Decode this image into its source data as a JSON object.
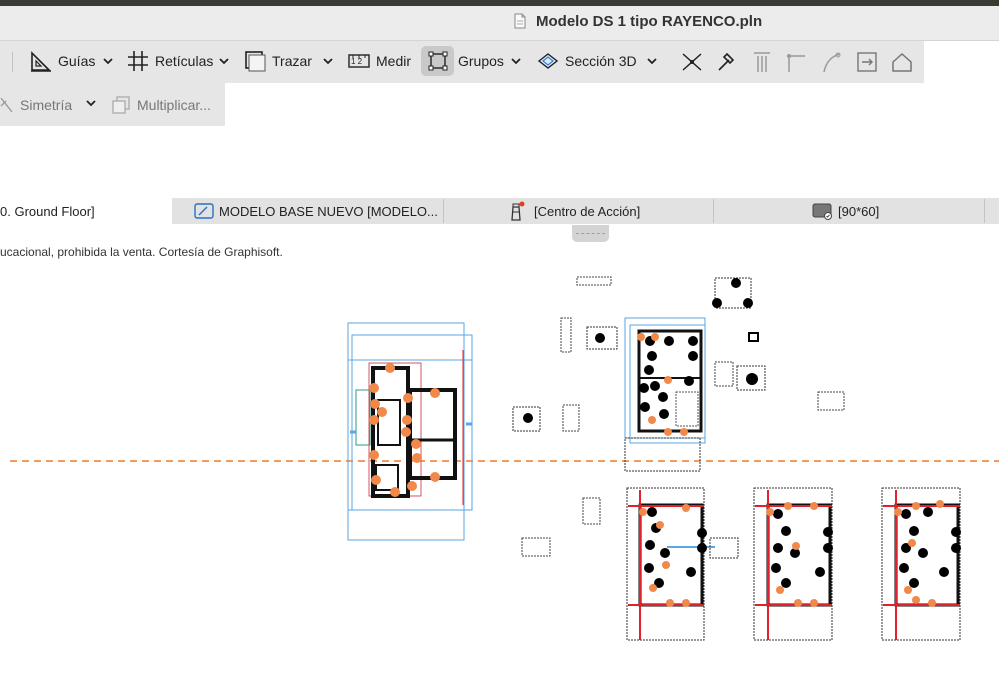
{
  "window": {
    "title": "Modelo DS 1 tipo RAYENCO.pln"
  },
  "toolbar": {
    "row1": [
      {
        "label": "Guías",
        "icon": "guides-icon"
      },
      {
        "label": "Retículas",
        "icon": "grid-icon"
      },
      {
        "label": "Trazar",
        "icon": "trace-icon"
      },
      {
        "label": "Medir",
        "icon": "ruler-icon"
      },
      {
        "label": "Grupos",
        "icon": "group-icon"
      },
      {
        "label": "Sección 3D",
        "icon": "section-3d-icon"
      }
    ],
    "row2": [
      {
        "label": "Simetría",
        "icon": "mirror-icon"
      },
      {
        "label": "Multiplicar...",
        "icon": "multiply-icon"
      }
    ]
  },
  "tabs": [
    {
      "label": "0. Ground Floor]",
      "active": true,
      "icon": "floor-plan-icon"
    },
    {
      "label": "MODELO BASE NUEVO [MODELO...",
      "active": false,
      "icon": "layout-icon"
    },
    {
      "label": "[Centro de Acción]",
      "active": false,
      "icon": "lighthouse-icon"
    },
    {
      "label": "[90*60]",
      "active": false,
      "icon": "view-icon"
    }
  ],
  "canvas": {
    "notice": "ucacional, prohibida la venta. Cortesía de Graphisoft.",
    "colors": {
      "selection": "#5aa6e6",
      "marker": "#f0894a",
      "red_line": "#e0202a",
      "guide": "#f07a2e"
    }
  }
}
